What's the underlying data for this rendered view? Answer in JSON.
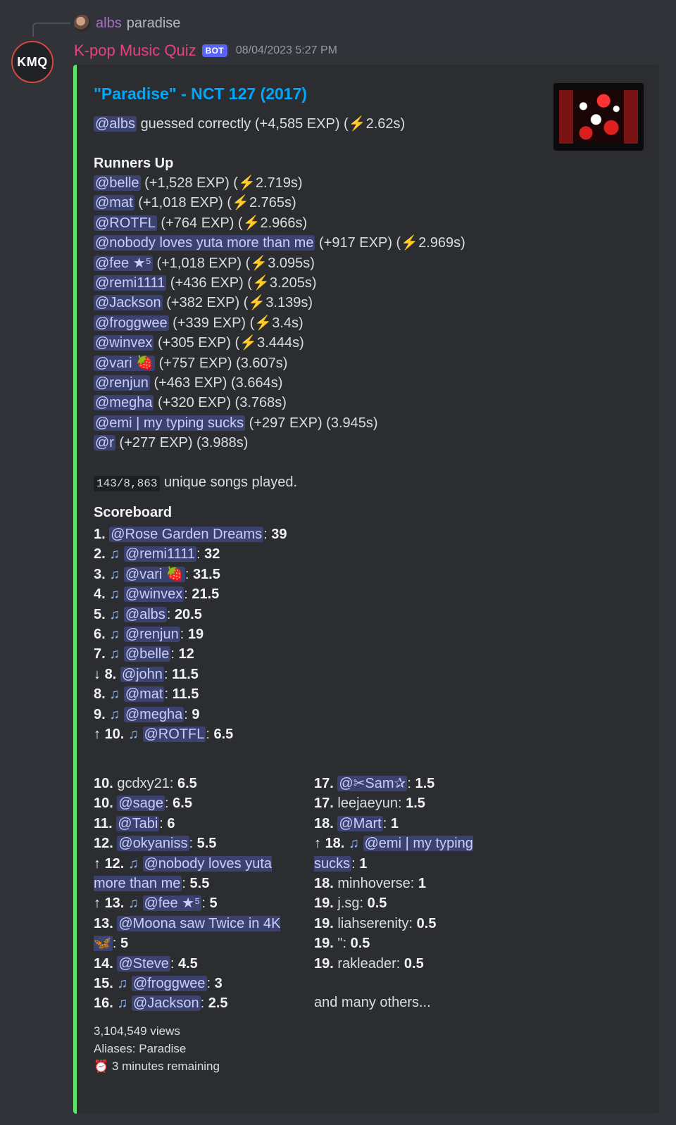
{
  "reply": {
    "name": "albs",
    "text": "paradise"
  },
  "avatar_text": "KMQ",
  "bot": {
    "name": "K-pop Music Quiz",
    "badge": "BOT",
    "timestamp": "08/04/2023 5:27 PM"
  },
  "embed": {
    "title": "\"Paradise\" - NCT 127 (2017)",
    "winner": {
      "mention": "@albs",
      "text": "guessed correctly (+4,585 EXP) (",
      "time": "2.62s)"
    },
    "runners_up_title": "Runners Up",
    "runners_up": [
      {
        "mention": "@belle",
        "exp": "(+1,528 EXP) (",
        "bolt": true,
        "time": "2.719s)"
      },
      {
        "mention": "@mat",
        "exp": "(+1,018 EXP) (",
        "bolt": true,
        "time": "2.765s)"
      },
      {
        "mention": "@ROTFL",
        "exp": "(+764 EXP) (",
        "bolt": true,
        "time": "2.966s)"
      },
      {
        "mention": "@nobody loves yuta more than me",
        "exp": "(+917 EXP) (",
        "bolt": true,
        "time": "2.969s)"
      },
      {
        "mention": "@fee ★⁵",
        "exp": "(+1,018 EXP) (",
        "bolt": true,
        "time": "3.095s)"
      },
      {
        "mention": "@remi1111",
        "exp": "(+436 EXP) (",
        "bolt": true,
        "time": "3.205s)"
      },
      {
        "mention": "@Jackson",
        "exp": "(+382 EXP) (",
        "bolt": true,
        "time": "3.139s)"
      },
      {
        "mention": "@froggwee",
        "exp": "(+339 EXP) (",
        "bolt": true,
        "time": "3.4s)"
      },
      {
        "mention": "@winvex",
        "exp": "(+305 EXP) (",
        "bolt": true,
        "time": "3.444s)"
      },
      {
        "mention": "@vari 🍓",
        "exp": "(+757 EXP) (",
        "bolt": false,
        "time": "3.607s)"
      },
      {
        "mention": "@renjun",
        "exp": "(+463 EXP) (",
        "bolt": false,
        "time": "3.664s)"
      },
      {
        "mention": "@megha",
        "exp": "(+320 EXP) (",
        "bolt": false,
        "time": "3.768s)"
      },
      {
        "mention": "@emi | my typing sucks",
        "exp": "(+297 EXP) (",
        "bolt": false,
        "time": "3.945s)"
      },
      {
        "mention": "@r",
        "exp": "(+277 EXP) (",
        "bolt": false,
        "time": "3.988s)"
      }
    ],
    "songs_code": "143/8,863",
    "songs_text": "unique songs played.",
    "scoreboard_title": "Scoreboard",
    "scoreboard": [
      {
        "arrow": "",
        "rank": "1.",
        "note": false,
        "mention": "@Rose Garden Dreams",
        "score": "39"
      },
      {
        "arrow": "",
        "rank": "2.",
        "note": true,
        "mention": "@remi1111",
        "score": "32"
      },
      {
        "arrow": "",
        "rank": "3.",
        "note": true,
        "mention": "@vari 🍓",
        "score": "31.5"
      },
      {
        "arrow": "",
        "rank": "4.",
        "note": true,
        "mention": "@winvex",
        "score": "21.5"
      },
      {
        "arrow": "",
        "rank": "5.",
        "note": true,
        "mention": "@albs",
        "score": "20.5"
      },
      {
        "arrow": "",
        "rank": "6.",
        "note": true,
        "mention": "@renjun",
        "score": "19"
      },
      {
        "arrow": "",
        "rank": "7.",
        "note": true,
        "mention": "@belle",
        "score": "12"
      },
      {
        "arrow": "↓",
        "rank": "8.",
        "note": false,
        "mention": "@john",
        "score": "11.5"
      },
      {
        "arrow": "",
        "rank": "8.",
        "note": true,
        "mention": "@mat",
        "score": "11.5"
      },
      {
        "arrow": "",
        "rank": "9.",
        "note": true,
        "mention": "@megha",
        "score": "9"
      },
      {
        "arrow": "↑",
        "rank": "10.",
        "note": true,
        "mention": "@ROTFL",
        "score": "6.5"
      }
    ],
    "left_col": [
      {
        "arrow": "",
        "rank": "10.",
        "note": false,
        "mention": "",
        "plain": "gcdxy21",
        "score": "6.5"
      },
      {
        "arrow": "",
        "rank": "10.",
        "note": false,
        "mention": "@sage",
        "plain": "",
        "score": "6.5"
      },
      {
        "arrow": "",
        "rank": "11.",
        "note": false,
        "mention": "@Tabi",
        "plain": "",
        "score": "6"
      },
      {
        "arrow": "",
        "rank": "12.",
        "note": false,
        "mention": "@okyaniss",
        "plain": "",
        "score": "5.5"
      },
      {
        "arrow": "↑",
        "rank": "12.",
        "note": true,
        "mention": "@nobody loves yuta more than me",
        "plain": "",
        "score": "5.5"
      },
      {
        "arrow": "↑",
        "rank": "13.",
        "note": true,
        "mention": "@fee ★⁵",
        "plain": "",
        "score": "5"
      },
      {
        "arrow": "",
        "rank": "13.",
        "note": false,
        "mention": "@Moona saw Twice in 4K 🦋",
        "plain": "",
        "score": "5"
      },
      {
        "arrow": "",
        "rank": "14.",
        "note": false,
        "mention": "@Steve",
        "plain": "",
        "score": "4.5"
      },
      {
        "arrow": "",
        "rank": "15.",
        "note": true,
        "mention": "@froggwee",
        "plain": "",
        "score": "3"
      },
      {
        "arrow": "",
        "rank": "16.",
        "note": true,
        "mention": "@Jackson",
        "plain": "",
        "score": "2.5"
      }
    ],
    "right_col": [
      {
        "arrow": "",
        "rank": "17.",
        "note": false,
        "mention": "@✂Sam✰",
        "plain": "",
        "score": "1.5"
      },
      {
        "arrow": "",
        "rank": "17.",
        "note": false,
        "mention": "",
        "plain": "leejaeyun",
        "score": "1.5"
      },
      {
        "arrow": "",
        "rank": "18.",
        "note": false,
        "mention": "@Mart",
        "plain": "",
        "score": "1"
      },
      {
        "arrow": "↑",
        "rank": "18.",
        "note": true,
        "mention": "@emi | my typing sucks",
        "plain": "",
        "score": "1"
      },
      {
        "arrow": "",
        "rank": "18.",
        "note": false,
        "mention": "",
        "plain": "minhoverse",
        "score": "1"
      },
      {
        "arrow": "",
        "rank": "19.",
        "note": false,
        "mention": "",
        "plain": "j.sg",
        "score": "0.5"
      },
      {
        "arrow": "",
        "rank": "19.",
        "note": false,
        "mention": "",
        "plain": "liahserenity",
        "score": "0.5"
      },
      {
        "arrow": "",
        "rank": "19.",
        "note": false,
        "mention": "",
        "plain": "\"",
        "score": "0.5"
      },
      {
        "arrow": "",
        "rank": "19.",
        "note": false,
        "mention": "",
        "plain": "rakleader",
        "score": "0.5"
      }
    ],
    "and_many_others": "and many others...",
    "footer": {
      "views": "3,104,549 views",
      "aliases": "Aliases: Paradise",
      "remaining": "⏰ 3 minutes remaining"
    }
  },
  "colors": {
    "embed_bar": "#5ee668",
    "title": "#00a8fc",
    "bot_name": "#e9407f",
    "mention_bg": "#3c4270"
  }
}
